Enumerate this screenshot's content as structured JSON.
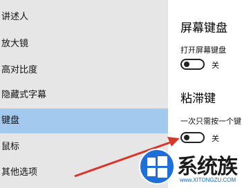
{
  "sidebar": {
    "items": [
      {
        "label": "讲述人"
      },
      {
        "label": "放大镜"
      },
      {
        "label": "高对比度"
      },
      {
        "label": "隐藏式字幕"
      },
      {
        "label": "键盘",
        "active": true
      },
      {
        "label": "鼠标"
      },
      {
        "label": "其他选项"
      }
    ]
  },
  "content": {
    "onscreen_keyboard": {
      "title": "屏幕键盘",
      "setting_label": "打开屏幕键盘",
      "toggle_state": "关",
      "enabled": false
    },
    "sticky_keys": {
      "title": "粘滞键",
      "setting_label": "一次只需按一个键",
      "toggle_state": "关",
      "enabled": false
    }
  },
  "watermark": {
    "text": "系统族",
    "url": "www.XITONGZU.COM"
  },
  "colors": {
    "sidebar_bg": "#e6e6e6",
    "active_item_bg": "#a3c9ee",
    "arrow": "#d9352b"
  }
}
